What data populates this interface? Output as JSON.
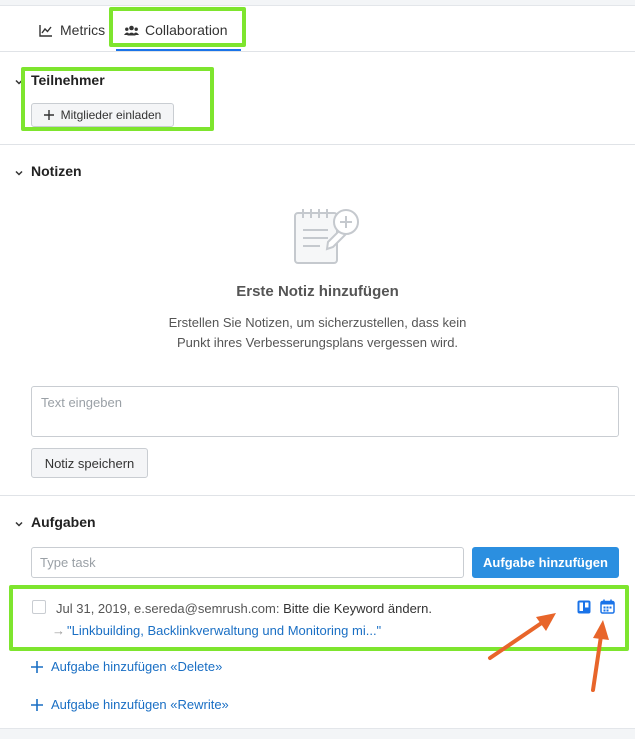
{
  "tabs": {
    "metrics_label": "Metrics",
    "collaboration_label": "Collaboration",
    "active": "Collaboration"
  },
  "participants": {
    "title": "Teilnehmer",
    "invite_button": "Mitglieder einladen"
  },
  "notes": {
    "title": "Notizen",
    "empty_title": "Erste Notiz hinzufügen",
    "empty_text": "Erstellen Sie Notizen, um sicherzustellen, dass kein Punkt ihres Verbesserungsplans vergessen wird.",
    "input_placeholder": "Text eingeben",
    "save_button": "Notiz speichern"
  },
  "tasks": {
    "title": "Aufgaben",
    "input_placeholder": "Type task",
    "add_button": "Aufgabe hinzufügen",
    "items": [
      {
        "meta": "Jul 31, 2019, e.sereda@semrush.com:",
        "text": "Bitte die Keyword ändern.",
        "link": "\"Linkbuilding, Backlinkverwaltung und Monitoring mi...\"",
        "checked": false,
        "icons": [
          "trello-icon",
          "calendar-icon"
        ]
      }
    ],
    "add_links": [
      "Aufgabe hinzufügen «Delete»",
      "Aufgabe hinzufügen «Rewrite»"
    ]
  },
  "colors": {
    "highlight": "#7ee52e",
    "accent": "#2b8fe0",
    "link": "#1a6fc4",
    "annotation_arrow": "#e8652a"
  }
}
